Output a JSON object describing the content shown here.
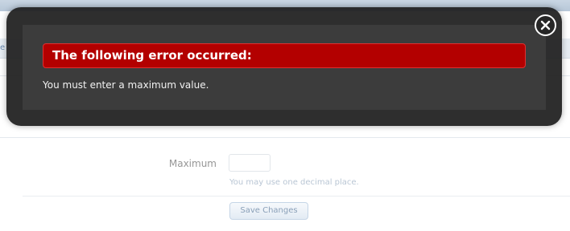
{
  "dialog": {
    "title": "The following error occurred:",
    "message": "You must enter a maximum value.",
    "close_icon": "close-icon",
    "colors": {
      "header_bg": "#b30000",
      "overlay_bg": "#1e1e1e"
    }
  },
  "form": {
    "field_label": "Maximum",
    "field_value": "",
    "field_hint": "You may use one decimal place.",
    "save_label": "Save Changes"
  },
  "background": {
    "nav_stub": "e"
  }
}
